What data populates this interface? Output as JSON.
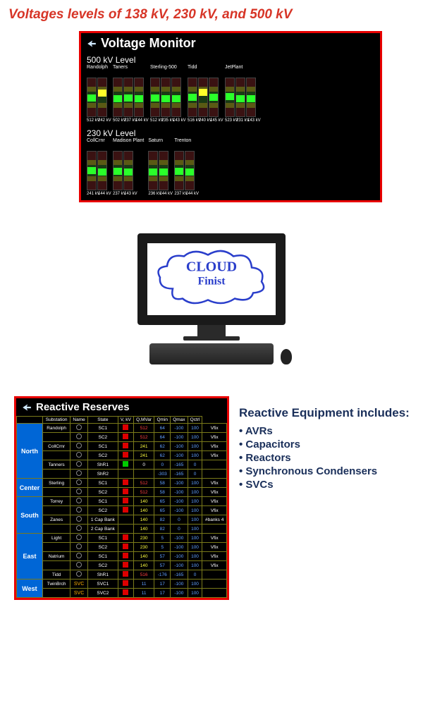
{
  "page_title": "Voltages levels of 138 kV, 230 kV, and 500 kV",
  "voltage_monitor": {
    "title": "Voltage Monitor",
    "levels": [
      {
        "label": "500 kV Level",
        "stations": [
          {
            "name": "Randolph",
            "bars": [
              {
                "v": "512 kV",
                "ind": "green",
                "pos": 42
              },
              {
                "v": "242 kV",
                "ind": "yellow",
                "pos": 30
              }
            ]
          },
          {
            "name": "Taners",
            "bars": [
              {
                "v": "502 kV",
                "ind": "green",
                "pos": 44
              },
              {
                "v": "237 kV",
                "ind": "green",
                "pos": 42
              },
              {
                "v": "144 kV",
                "ind": "green",
                "pos": 44
              }
            ]
          },
          {
            "name": "Sterling-500",
            "bars": [
              {
                "v": "512 kV",
                "ind": "green",
                "pos": 42
              },
              {
                "v": "235 kV",
                "ind": "green",
                "pos": 44
              },
              {
                "v": "143 kV",
                "ind": "green",
                "pos": 44
              }
            ]
          },
          {
            "name": "Tidd",
            "bars": [
              {
                "v": "516 kV",
                "ind": "green",
                "pos": 40
              },
              {
                "v": "240 kV",
                "ind": "yellow",
                "pos": 28
              },
              {
                "v": "145 kV",
                "ind": "green",
                "pos": 40
              }
            ]
          },
          {
            "name": "JetPlant",
            "bars": [
              {
                "v": "523 kV",
                "ind": "green",
                "pos": 38
              },
              {
                "v": "231 kV",
                "ind": "green",
                "pos": 44
              },
              {
                "v": "143 kV",
                "ind": "green",
                "pos": 44
              }
            ]
          }
        ]
      },
      {
        "label": "230 kV Level",
        "stations": [
          {
            "name": "CollCrnr",
            "bars": [
              {
                "v": "241 kV",
                "ind": "green",
                "pos": 40
              },
              {
                "v": "144 kV",
                "ind": "green",
                "pos": 44
              }
            ]
          },
          {
            "name": "Madison Plant",
            "bars": [
              {
                "v": "237 kV",
                "ind": "green",
                "pos": 42
              },
              {
                "v": "143 kV",
                "ind": "green",
                "pos": 44
              }
            ]
          },
          {
            "name": "Saturn",
            "bars": [
              {
                "v": "236 kV",
                "ind": "green",
                "pos": 44
              },
              {
                "v": "144 kV",
                "ind": "green",
                "pos": 44
              }
            ]
          },
          {
            "name": "Trenton",
            "bars": [
              {
                "v": "237 kV",
                "ind": "green",
                "pos": 42
              },
              {
                "v": "144 kV",
                "ind": "green",
                "pos": 44
              }
            ]
          }
        ]
      }
    ]
  },
  "cloud": {
    "line1": "CLOUD",
    "line2": "Finist"
  },
  "reactive_reserves": {
    "title": "Reactive Reserves",
    "headers": [
      "",
      "Substation",
      "Name",
      "State",
      "V, kV",
      "Q,MVar",
      "Qmin",
      "Qmax",
      "Qctrl"
    ],
    "regions": [
      {
        "name": "North",
        "rows": [
          {
            "sub": "Randolph",
            "name": "SC1",
            "state": "red",
            "v": "512",
            "vc": "red",
            "q": "64",
            "qmin": "-100",
            "qmax": "100",
            "qctrl": "Vfix"
          },
          {
            "sub": "",
            "name": "SC2",
            "state": "red",
            "v": "512",
            "vc": "red",
            "q": "64",
            "qmin": "-100",
            "qmax": "100",
            "qctrl": "Vfix"
          },
          {
            "sub": "CollCrnr",
            "name": "SC1",
            "state": "red",
            "v": "241",
            "vc": "yel",
            "q": "62",
            "qmin": "-100",
            "qmax": "100",
            "qctrl": "Vfix"
          },
          {
            "sub": "",
            "name": "SC2",
            "state": "red",
            "v": "241",
            "vc": "yel",
            "q": "62",
            "qmin": "-100",
            "qmax": "100",
            "qctrl": "Vfix"
          },
          {
            "sub": "Tanners",
            "name": "ShR1",
            "state": "green",
            "v": "0",
            "vc": "white",
            "q": "0",
            "qmin": "-165",
            "qmax": "0",
            "qctrl": ""
          },
          {
            "sub": "",
            "name": "ShR2",
            "state": "",
            "v": "",
            "vc": "",
            "q": "-303",
            "qmin": "-165",
            "qmax": "0",
            "qctrl": ""
          }
        ]
      },
      {
        "name": "Center",
        "rows": [
          {
            "sub": "Sterling",
            "name": "SC1",
            "state": "red",
            "v": "512",
            "vc": "red",
            "q": "58",
            "qmin": "-100",
            "qmax": "100",
            "qctrl": "Vfix"
          },
          {
            "sub": "",
            "name": "SC2",
            "state": "red",
            "v": "512",
            "vc": "red",
            "q": "58",
            "qmin": "-100",
            "qmax": "100",
            "qctrl": "Vfix"
          }
        ]
      },
      {
        "name": "South",
        "rows": [
          {
            "sub": "Torrey",
            "name": "SC1",
            "state": "red",
            "v": "140",
            "vc": "yel",
            "q": "65",
            "qmin": "-100",
            "qmax": "100",
            "qctrl": "Vfix"
          },
          {
            "sub": "",
            "name": "SC2",
            "state": "red",
            "v": "140",
            "vc": "yel",
            "q": "65",
            "qmin": "-100",
            "qmax": "100",
            "qctrl": "Vfix"
          },
          {
            "sub": "Zanes",
            "name": "1 Cap Bank",
            "state": "",
            "v": "140",
            "vc": "yel",
            "q": "82",
            "qmin": "0",
            "qmax": "100",
            "qctrl": "#banks 4"
          },
          {
            "sub": "",
            "name": "2 Cap Bank",
            "state": "",
            "v": "140",
            "vc": "yel",
            "q": "82",
            "qmin": "0",
            "qmax": "100",
            "qctrl": ""
          }
        ]
      },
      {
        "name": "East",
        "rows": [
          {
            "sub": "Light",
            "name": "SC1",
            "state": "red",
            "v": "230",
            "vc": "yel",
            "q": "5",
            "qmin": "-100",
            "qmax": "100",
            "qctrl": "Vfix"
          },
          {
            "sub": "",
            "name": "SC2",
            "state": "red",
            "v": "230",
            "vc": "yel",
            "q": "5",
            "qmin": "-100",
            "qmax": "100",
            "qctrl": "Vfix"
          },
          {
            "sub": "Natrium",
            "name": "SC1",
            "state": "red",
            "v": "140",
            "vc": "yel",
            "q": "57",
            "qmin": "-100",
            "qmax": "100",
            "qctrl": "Vfix"
          },
          {
            "sub": "",
            "name": "SC2",
            "state": "red",
            "v": "140",
            "vc": "yel",
            "q": "57",
            "qmin": "-100",
            "qmax": "100",
            "qctrl": "Vfix"
          },
          {
            "sub": "Tidd",
            "name": "ShR1",
            "state": "red",
            "v": "516",
            "vc": "red",
            "q": "-176",
            "qmin": "-165",
            "qmax": "0",
            "qctrl": ""
          }
        ]
      },
      {
        "name": "West",
        "rows": [
          {
            "sub": "TwinBrch",
            "name": "SVC1",
            "state": "red",
            "v": "11",
            "vc": "blue",
            "q": "17",
            "qmin": "-100",
            "qmax": "100",
            "qctrl": ""
          },
          {
            "sub": "",
            "name": "SVC2",
            "state": "red",
            "v": "11",
            "vc": "blue",
            "q": "17",
            "qmin": "-100",
            "qmax": "100",
            "qctrl": ""
          }
        ]
      }
    ]
  },
  "equipment": {
    "title": "Reactive Equipment includes:",
    "items": [
      "AVRs",
      "Capacitors",
      "Reactors",
      "Synchronous Condensers",
      "SVCs"
    ]
  }
}
